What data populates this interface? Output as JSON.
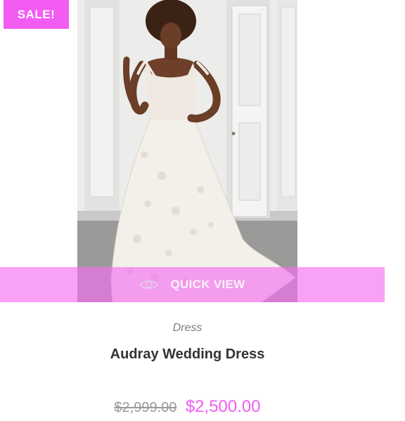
{
  "product": {
    "badge": "SALE!",
    "quick_view_label": "QUICK VIEW",
    "category": "Dress",
    "title": "Audray Wedding Dress",
    "price_old": "$2,999.00",
    "price_new": "$2,500.00"
  },
  "colors": {
    "accent": "#f35cf3",
    "overlay": "#f56ef0",
    "text_dark": "#333333",
    "text_muted": "#7d7d7d"
  },
  "icons": {
    "quick_view": "eye-icon"
  }
}
